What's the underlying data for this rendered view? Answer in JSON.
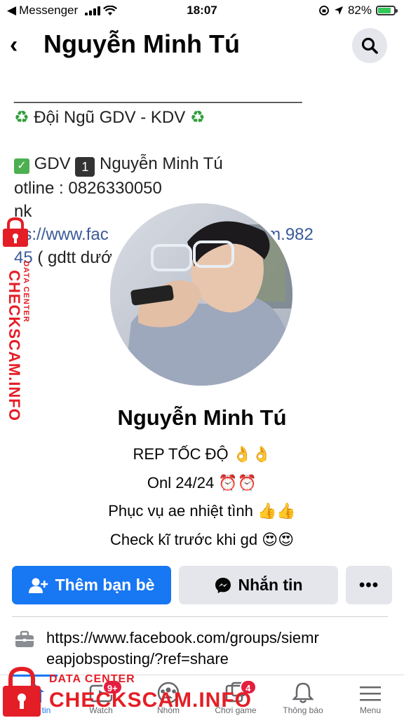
{
  "status_bar": {
    "back_app": "Messenger",
    "time": "18:07",
    "battery_percent": "82%",
    "battery_level": 0.82
  },
  "header": {
    "title": "Nguyễn Minh Tú"
  },
  "cover": {
    "line1": "____________________________________",
    "line2_emoji": "♻️",
    "line2": "Đội Ngũ GDV - KDV",
    "line3_gdv": "GDV",
    "line3_num": "1",
    "line3_name": "Nguyễn Minh Tú",
    "line4": "otline : 0826330050",
    "line5": "nk",
    "line6_left": "ps://www.fac",
    "line6_right": "thien.pham.982",
    "line7_link": "45",
    "line7_rest": " ( gdtt dướ",
    "line8": "___________                                    __"
  },
  "profile": {
    "name": "Nguyễn Minh Tú",
    "bio": [
      "REP TỐC ĐỘ 👌👌",
      "Onl 24/24 ⏰⏰",
      "Phục vụ ae nhiệt tình 👍👍",
      "Check kĩ trước khi gd 😍😍"
    ]
  },
  "actions": {
    "add_friend": "Thêm bạn bè",
    "message": "Nhắn tin",
    "more": "•••"
  },
  "intro": {
    "link": "https://www.facebook.com/groups/siemreapjobsposting/?ref=share"
  },
  "bottom_nav": {
    "items": [
      {
        "label": "Bảng tin",
        "icon": "home-icon"
      },
      {
        "label": "Watch",
        "icon": "watch-icon",
        "badge": "9+"
      },
      {
        "label": "Nhóm",
        "icon": "groups-icon"
      },
      {
        "label": "Chơi game",
        "icon": "gaming-icon",
        "badge": "4"
      },
      {
        "label": "Thông báo",
        "icon": "bell-icon"
      },
      {
        "label": "Menu",
        "icon": "menu-icon"
      }
    ],
    "visible_label_0": "tin"
  },
  "watermark": {
    "sub": "DATA CENTER",
    "brand": "CHECKSCAM.INFO"
  },
  "colors": {
    "accent": "#1877f2",
    "watermark": "#e41e26",
    "badge": "#e41e3f"
  }
}
